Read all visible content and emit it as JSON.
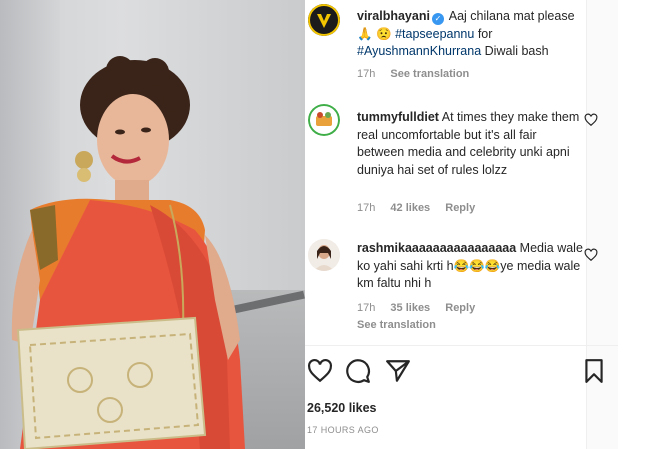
{
  "post": {
    "author": "viralbhayani",
    "caption_text": "Aaj chilana mat please",
    "caption_emoji": "🙏 😟",
    "hashtag1": "#tapseepannu",
    "caption_for": "for",
    "hashtag2": "#AyushmannKhurrana",
    "caption_tail": "Diwali bash",
    "time": "17h",
    "see_translation": "See translation"
  },
  "comments": [
    {
      "user": "tummyfulldiet",
      "text": "At times they make them real uncomfortable but it's all fair between media and celebrity unki apni duniya hai set of rules lolzz",
      "time": "17h",
      "likes": "42 likes",
      "reply": "Reply"
    },
    {
      "user": "rashmikaaaaaaaaaaaaaaaa",
      "text_a": "Media wale ko yahi sahi krti h",
      "emoji": "😂😂😂",
      "text_b": "ye media wale km faltu nhi h",
      "time": "17h",
      "likes": "35 likes",
      "reply": "Reply",
      "see_translation": "See translation"
    }
  ],
  "footer": {
    "likes": "26,520 likes",
    "posted": "17 HOURS AGO"
  },
  "icons": {
    "like": "heart-icon",
    "comment": "comment-icon",
    "share": "send-icon",
    "save": "bookmark-icon"
  },
  "colors": {
    "link": "#00376b",
    "muted": "#8e8e8e",
    "verified": "#3897f0"
  }
}
